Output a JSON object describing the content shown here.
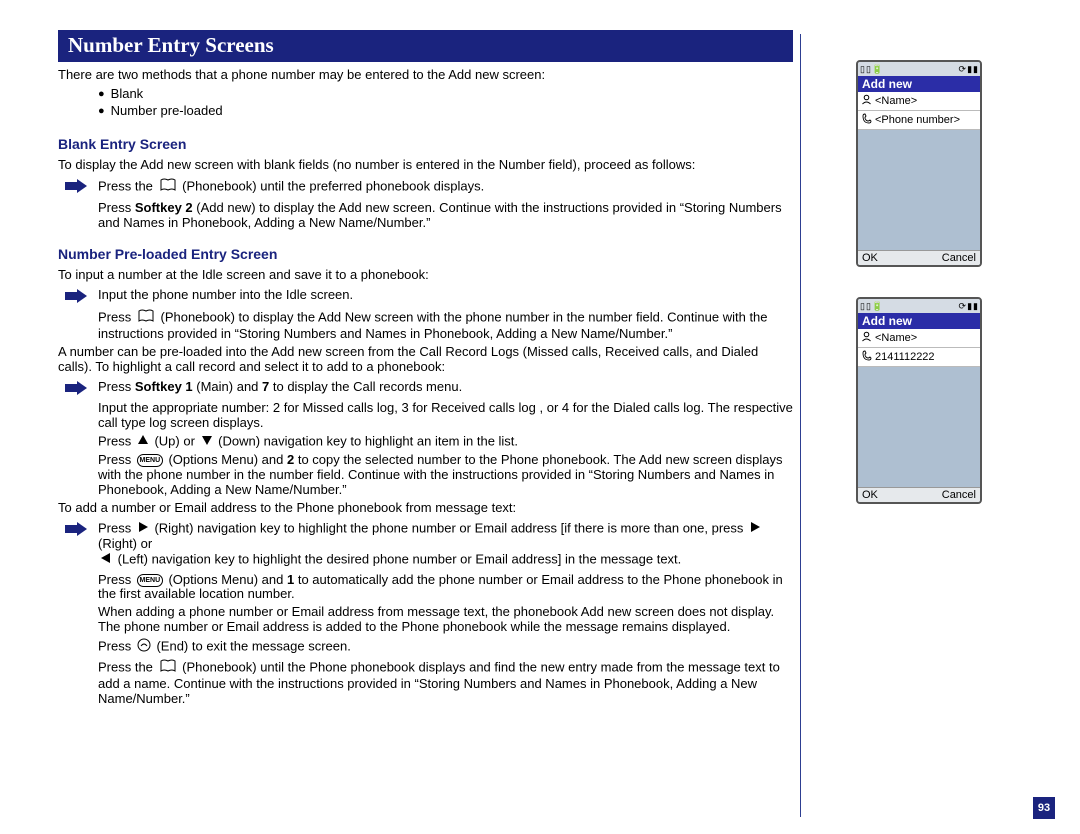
{
  "header": "Number Entry Screens",
  "intro": "There are two methods that a phone number may be entered to the Add new screen:",
  "methods": [
    "Blank",
    "Number pre-loaded"
  ],
  "blank": {
    "title": "Blank Entry Screen",
    "lead": "To display the Add new screen with blank fields (no number is entered in the Number field), proceed as follows:",
    "step1": "Press the",
    "step1b": "(Phonebook) until the preferred phonebook displays.",
    "sub1a": "Press ",
    "sub1b": "Softkey 2",
    "sub1c": " (Add new) to display the Add new screen. Continue with the instructions provided in “Storing Numbers and Names in Phonebook, Adding a New Name/Number.”"
  },
  "preloaded": {
    "title": "Number Pre-loaded Entry Screen",
    "lead": "To input a number at the Idle screen and save it to a phonebook:",
    "step1": "Input the phone number into the Idle screen.",
    "sub1a": "Press",
    "sub1b": "(Phonebook) to display the Add New screen with the phone number in the number field. Continue with the instructions provided in “Storing Numbers and Names in Phonebook, Adding a New Name/Number.”",
    "para2": "A number can be pre-loaded into the Add new screen from the Call Record Logs (Missed calls, Received calls, and Dialed calls). To highlight a call record and select it to add to a phonebook:",
    "step2a": "Press ",
    "step2b": "Softkey 1",
    "step2c": " (Main) and ",
    "step2d": "7",
    "step2e": " to display the Call records menu.",
    "sub2": "Input the appropriate number: 2 for Missed calls log, 3 for Received calls log , or 4 for the Dialed calls log. The respective call type log screen displays.",
    "sub3a": "Press ",
    "sub3b": " (Up) or ",
    "sub3c": " (Down) navigation key to highlight an item in the list.",
    "sub4a": "Press ",
    "sub4b": " (Options Menu) and ",
    "sub4c": "2",
    "sub4d": " to copy the selected number to the Phone phonebook. The Add new screen displays with the phone number in the number field. Continue with the instructions provided in “Storing Numbers and Names in Phonebook, Adding a New Name/Number.”",
    "para3": "To add a number or Email address to the Phone phonebook from message text:",
    "step3a": "Press ",
    "step3b": " (Right) navigation key to highlight the phone number or Email address [if there is more than one, press ",
    "step3c": " (Right) or ",
    "step3d": " (Left) navigation key to highlight the desired phone number or Email address] in the message text.",
    "sub5a": "Press ",
    "sub5b": " (Options Menu) and ",
    "sub5c": "1",
    "sub5d": " to automatically add the phone number or Email address to the Phone phonebook in the first available location number.",
    "sub6": "When adding a phone number or Email address from message text, the phonebook Add new screen does not display. The phone number or Email address is added to the Phone phonebook while the message remains displayed.",
    "sub7a": "Press ",
    "sub7b": " (End) to exit the message screen.",
    "sub8a": "Press the ",
    "sub8b": " (Phonebook) until the Phone phonebook displays and find the new entry made from the message text to add a name. Continue with the instructions provided in “Storing Numbers and Names in Phonebook, Adding a New Name/Number.”"
  },
  "phone1": {
    "title": "Add new",
    "row1": "<Name>",
    "row2": "<Phone number>",
    "sk_left": "OK",
    "sk_right": "Cancel",
    "fill_h": "120"
  },
  "phone2": {
    "title": "Add new",
    "row1": "<Name>",
    "row2": "2141112222",
    "sk_left": "OK",
    "sk_right": "Cancel",
    "fill_h": "120"
  },
  "page_number": "93",
  "icons": {
    "menu_label": "MENU"
  }
}
